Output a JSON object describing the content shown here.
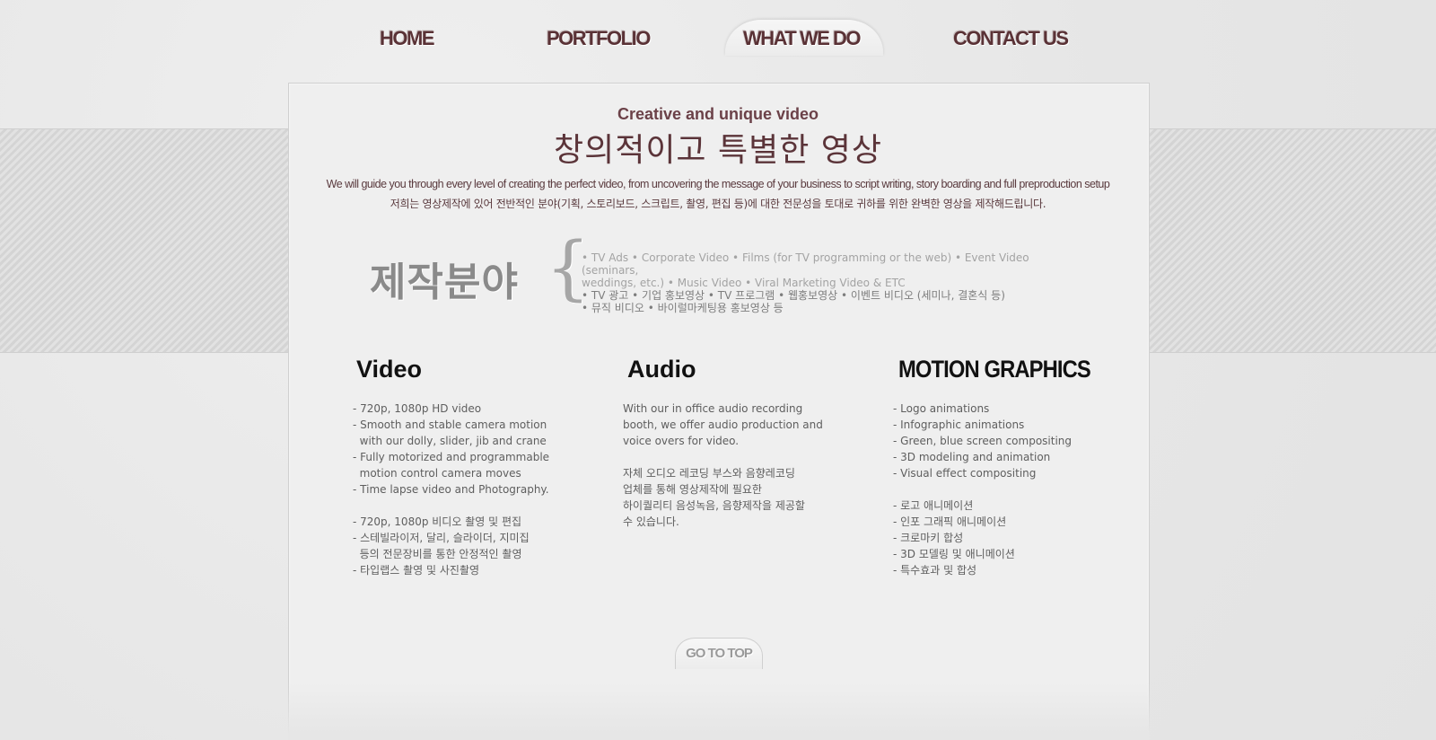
{
  "nav": {
    "home": "HOME",
    "portfolio": "PORTFOLIO",
    "what_we_do": "WHAT WE DO",
    "contact_us": "CONTACT US",
    "active": "WHAT WE DO"
  },
  "header": {
    "subtitle_en": "Creative and unique video",
    "title_ko": "창의적이고 특별한 영상",
    "intro_en": "We will guide you through every level of creating the perfect video, from uncovering the message of your business to script writing, story boarding and full preproduction setup",
    "intro_ko": "저희는 영상제작에 있어 전반적인 분야(기획, 스토리보드, 스크립트, 촬영, 편집 등)에 대한 전문성을 토대로 귀하를 위한 완벽한 영상을 제작해드립니다."
  },
  "fields": {
    "label": "제작분야",
    "brace": "{",
    "en_line1": "• TV Ads   • Corporate Video   • Films (for TV programming or the web)   • Event Video (seminars,",
    "en_line2": "weddings, etc.)   • Music Video   • Viral Marketing Video & ETC",
    "ko_line1": "• TV 광고   • 기업 홍보영상   • TV 프로그램   • 웹홍보영상   • 이벤트 비디오 (세미나, 결혼식 등)",
    "ko_line2": "• 뮤직 비디오   • 바이럴마케팅용 홍보영상 등"
  },
  "columns": {
    "video": {
      "title": "Video",
      "text": "- 720p, 1080p HD video\n- Smooth and stable camera motion\n  with our dolly, slider, jib and crane\n- Fully motorized and programmable\n  motion control camera moves\n- Time lapse video and Photography.\n\n- 720p, 1080p 비디오 촬영 및 편집\n- 스테빌라이저, 달리, 슬라이더, 지미집\n  등의 전문장비를 통한 안정적인 촬영\n- 타입랩스 촬영 및 사진촬영"
    },
    "audio": {
      "title": "Audio",
      "text": "With our in office audio recording\nbooth, we offer audio production and\nvoice overs for video.\n\n자체 오디오 레코딩 부스와 음향레코딩\n업체를 통해 영상제작에 필요한\n하이퀄리티 음성녹음, 음향제작을 제공할\n수 있습니다."
    },
    "motion": {
      "title": "MOTION GRAPHICS",
      "text": "- Logo animations\n- Infographic animations\n- Green, blue screen compositing\n- 3D modeling and animation\n- Visual effect compositing\n\n- 로고 애니메이션\n- 인포 그래픽 애니메이션\n- 크로마키 합성\n- 3D 모델링 및 애니메이션\n- 특수효과 및 합성"
    }
  },
  "footer": {
    "go_to_top": "GO TO TOP"
  },
  "colors": {
    "brand": "#5a3236",
    "background": "#e9e9e9",
    "panel": "#efefef"
  }
}
